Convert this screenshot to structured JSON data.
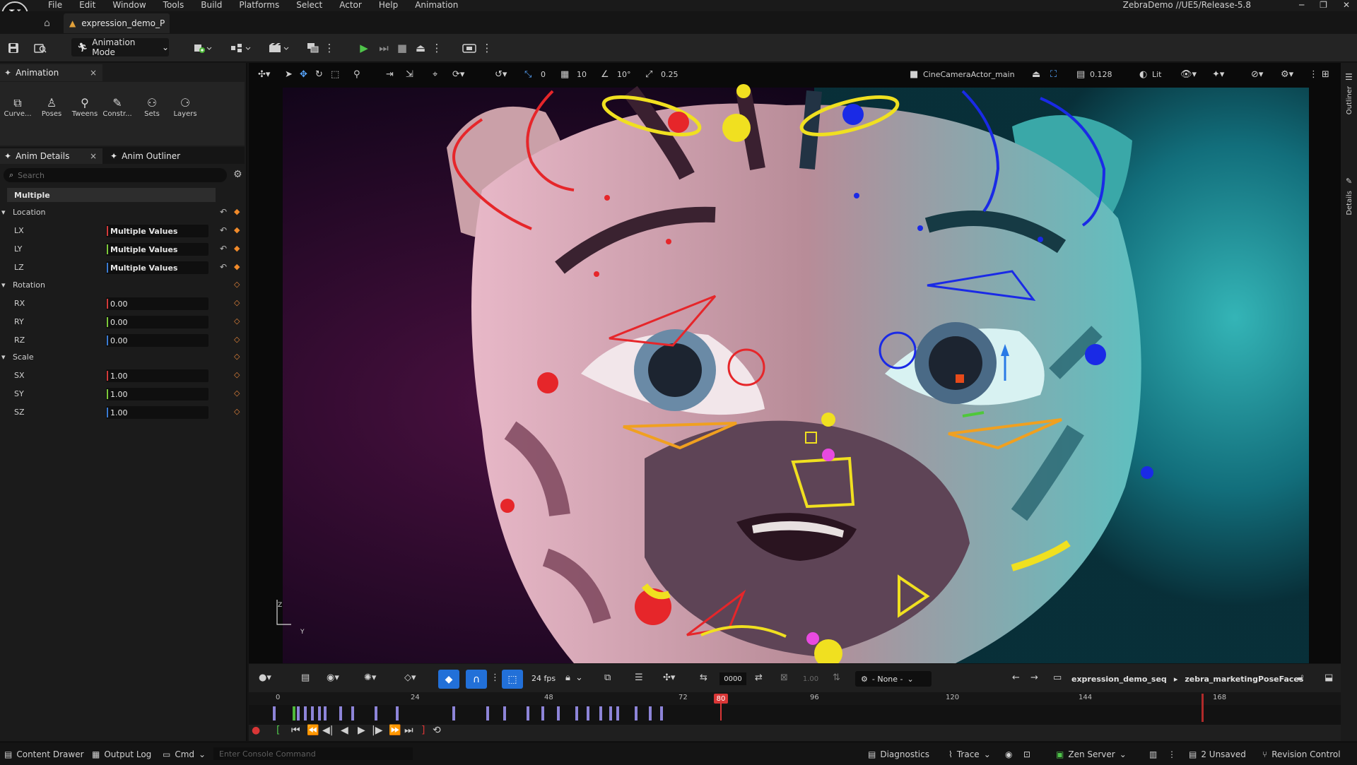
{
  "app": {
    "logo": "U",
    "menu": [
      "File",
      "Edit",
      "Window",
      "Tools",
      "Build",
      "Platforms",
      "Select",
      "Actor",
      "Help",
      "Animation"
    ],
    "project": "ZebraDemo //UE5/Release-5.8",
    "window_controls": {
      "minimize": "─",
      "restore": "❐",
      "close": "✕"
    }
  },
  "tabs": {
    "document": "expression_demo_P"
  },
  "toolbar": {
    "mode": "Animation Mode"
  },
  "animation_panel": {
    "tab": "Animation",
    "close": "×",
    "tools": [
      {
        "icon": "curve-icon",
        "label": "Curve..."
      },
      {
        "icon": "poses-icon",
        "label": "Poses"
      },
      {
        "icon": "tweens-icon",
        "label": "Tweens"
      },
      {
        "icon": "constraint-icon",
        "label": "Constr..."
      },
      {
        "icon": "sets-icon",
        "label": "Sets"
      },
      {
        "icon": "layers-icon",
        "label": "Layers"
      }
    ]
  },
  "details": {
    "tab_details": "Anim Details",
    "tab_outliner": "Anim Outliner",
    "close": "×",
    "search_placeholder": "Search",
    "header": "Multiple",
    "location": {
      "label": "Location",
      "fields": [
        {
          "name": "LX",
          "value": "Multiple Values"
        },
        {
          "name": "LY",
          "value": "Multiple Values"
        },
        {
          "name": "LZ",
          "value": "Multiple Values"
        }
      ]
    },
    "rotation": {
      "label": "Rotation",
      "fields": [
        {
          "name": "RX",
          "value": "0.00"
        },
        {
          "name": "RY",
          "value": "0.00"
        },
        {
          "name": "RZ",
          "value": "0.00"
        }
      ]
    },
    "scale": {
      "label": "Scale",
      "fields": [
        {
          "name": "SX",
          "value": "1.00"
        },
        {
          "name": "SY",
          "value": "1.00"
        },
        {
          "name": "SZ",
          "value": "1.00"
        }
      ]
    },
    "axis_colors": {
      "x": "#d23a3a",
      "y": "#7cc83a",
      "z": "#3a7ad2"
    }
  },
  "viewport": {
    "grid_angle": "0",
    "snap_grid": "10",
    "snap_rotation": "10°",
    "snap_scale": "0.25",
    "camera": "CineCameraActor_main",
    "camera_speed": "0.128",
    "view_mode": "Lit",
    "axis_z": "Z",
    "axis_y": "Y"
  },
  "right_strip": {
    "outliner": "Outliner",
    "details": "Details"
  },
  "sequencer": {
    "fps": "24 fps",
    "frame": "0000",
    "speed": "1.00",
    "camera_none": "- None -",
    "sequence": "expression_demo_seq",
    "subsequence": "zebra_marketingPoseFaces",
    "ruler": [
      "0",
      "24",
      "48",
      "72",
      "96",
      "120",
      "144",
      "168"
    ],
    "playhead": "80",
    "keyframe_color": "#8d84d8"
  },
  "statusbar": {
    "content_drawer": "Content Drawer",
    "output_log": "Output Log",
    "cmd": "Cmd",
    "console_placeholder": "Enter Console Command",
    "diagnostics": "Diagnostics",
    "trace": "Trace",
    "zen": "Zen Server",
    "unsaved": "2 Unsaved",
    "revision": "Revision Control"
  }
}
